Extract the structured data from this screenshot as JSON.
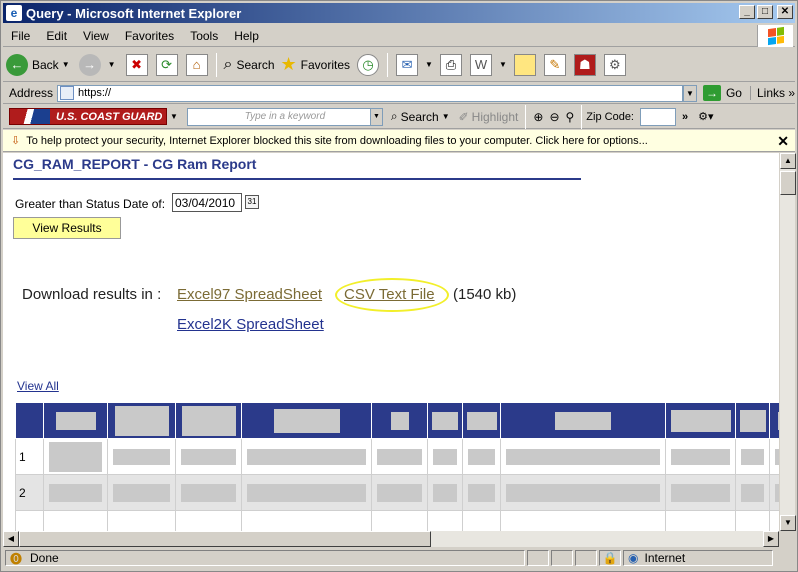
{
  "window": {
    "title": "Query - Microsoft Internet Explorer"
  },
  "menu": [
    "File",
    "Edit",
    "View",
    "Favorites",
    "Tools",
    "Help"
  ],
  "toolbar": {
    "back": "Back",
    "search": "Search",
    "favorites": "Favorites"
  },
  "address": {
    "label": "Address",
    "url": "https://",
    "go": "Go",
    "links": "Links"
  },
  "cgbar": {
    "logo": "U.S. COAST GUARD",
    "keyword_placeholder": "Type in a keyword",
    "search": "Search",
    "highlight": "Highlight",
    "zip_label": "Zip Code:"
  },
  "infobar": {
    "text": "To help protect your security, Internet Explorer blocked this site from downloading files to your computer. Click here for options..."
  },
  "page": {
    "title": "CG_RAM_REPORT - CG Ram Report",
    "date_label": "Greater than Status Date of:",
    "date_value": "03/04/2010",
    "view_button": "View Results",
    "download_label": "Download results in :",
    "excel97": "Excel97 SpreadSheet",
    "csv": "CSV Text File",
    "csv_size": "(1540 kb)",
    "excel2k": "Excel2K SpreadSheet",
    "view_all": "View All"
  },
  "table": {
    "rows": [
      "1",
      "2"
    ]
  },
  "status": {
    "text": "Done",
    "zone": "Internet"
  },
  "colors": {
    "header_blue": "#2b3a8a",
    "highlight_ring": "#f2ef2a",
    "button_yellow": "#ffff99"
  }
}
